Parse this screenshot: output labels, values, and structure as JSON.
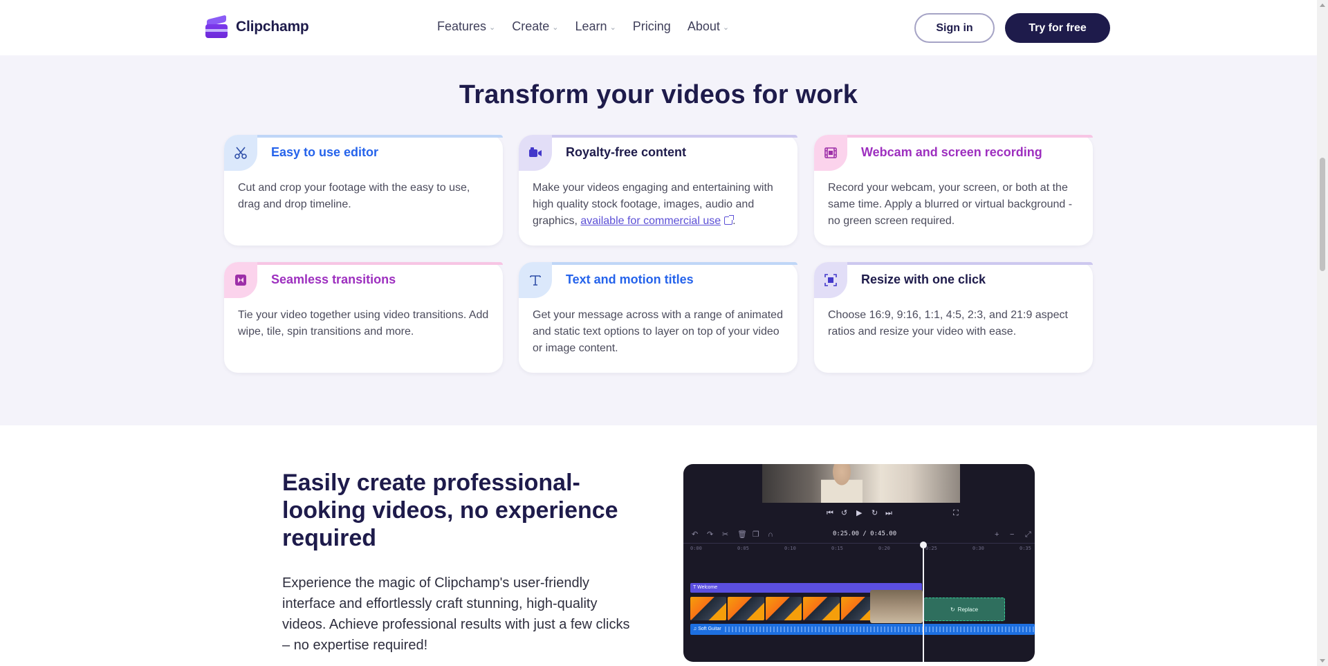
{
  "nav": {
    "brand": "Clipchamp",
    "menu": [
      {
        "label": "Features",
        "chevron": true
      },
      {
        "label": "Create",
        "chevron": true
      },
      {
        "label": "Learn",
        "chevron": true
      },
      {
        "label": "Pricing",
        "chevron": false
      },
      {
        "label": "About",
        "chevron": true
      }
    ],
    "signin": "Sign in",
    "try": "Try for free"
  },
  "features": {
    "title": "Transform your videos for work",
    "cards": [
      {
        "title": "Easy to use editor",
        "icon": "scissors-icon",
        "desc": "Cut and crop your footage with the easy to use, drag and drop timeline.",
        "accent": "#3b82f6",
        "bg": "#dbeafe",
        "iconColor": "#2f4fa8"
      },
      {
        "title": "Royalty-free content",
        "icon": "video-camera-icon",
        "desc_pre": "Make your videos engaging and entertaining with high quality stock footage, images, audio and graphics, ",
        "link": "available for commercial use",
        "desc_post": ".",
        "accent": "#1e1b4b",
        "bg": "#e0e0f8",
        "iconColor": "#4338ca"
      },
      {
        "title": "Webcam and screen recording",
        "icon": "film-icon",
        "desc": "Record your webcam, your screen, or both at the same time. Apply a blurred or virtual background - no green screen required.",
        "accent": "#9333ea",
        "bg": "#fbcfe8",
        "iconColor": "#9d2fa8"
      },
      {
        "title": "Seamless transitions",
        "icon": "transition-icon",
        "desc": "Tie your video together using video transitions. Add wipe, tile, spin transitions and more.",
        "accent": "#9333ea",
        "bg": "#fbcfe8",
        "iconColor": "#9d2fa8"
      },
      {
        "title": "Text and motion titles",
        "icon": "text-icon",
        "desc": "Get your message across with a range of animated and static text options to layer on top of your video or image content.",
        "accent": "#2563eb",
        "bg": "#dbeafe",
        "iconColor": "#2f4fa8"
      },
      {
        "title": "Resize with one click",
        "icon": "resize-icon",
        "desc": "Choose 16:9, 9:16, 1:1, 4:5, 2:3, and 21:9 aspect ratios and resize your video with ease.",
        "accent": "#1e1b4b",
        "bg": "#e4ddf7",
        "iconColor": "#4338ca"
      }
    ]
  },
  "hero": {
    "title": "Easily create professional-looking videos, no experience required",
    "desc": "Experience the magic of Clipchamp's user-friendly interface and effortlessly craft stunning, high-quality videos. Achieve professional results with just a few clicks – no expertise required!"
  },
  "editor": {
    "timecode": "0:25.00 / 0:45.00",
    "ticks": [
      "0:00",
      "0:05",
      "0:10",
      "0:15",
      "0:20",
      "0:25",
      "0:30",
      "0:35"
    ],
    "text_track": "Welcome",
    "replace": "Replace",
    "audio_track": "Soft Guitar"
  },
  "colors": {
    "navy": "#1e1b4b",
    "section_bg": "#f4f3fa"
  }
}
